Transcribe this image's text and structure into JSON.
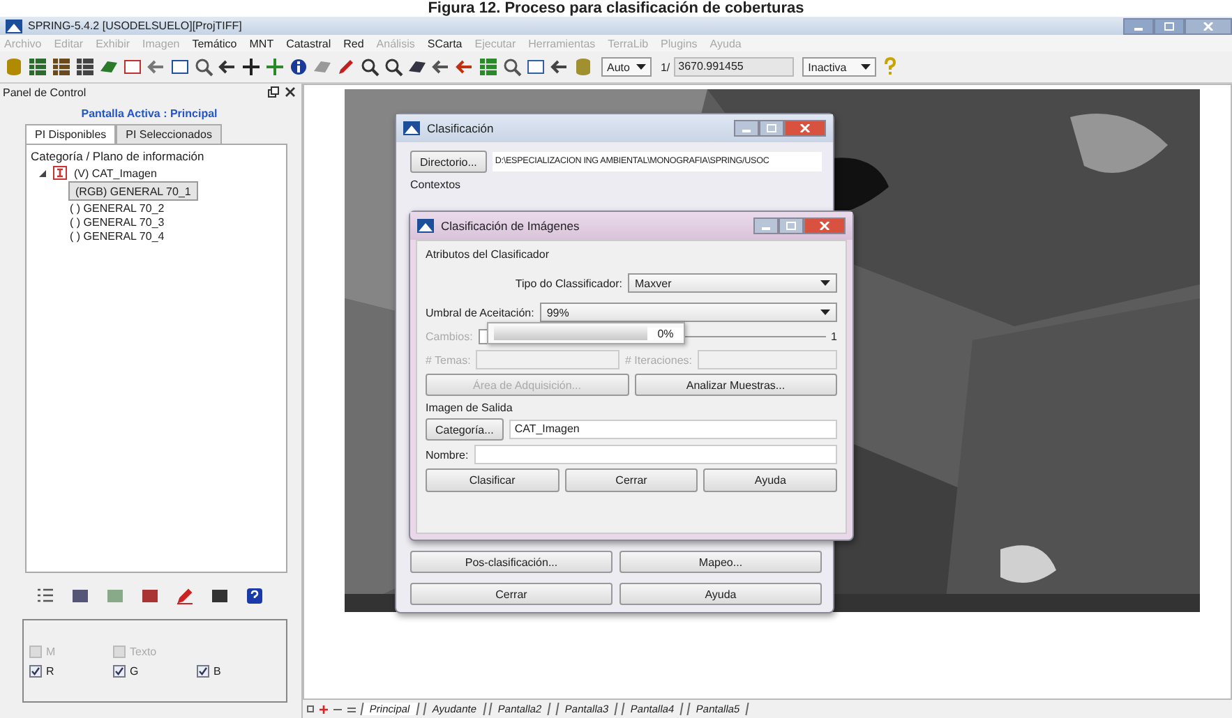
{
  "caption": "Figura 12. Proceso para clasificación de coberturas",
  "window": {
    "title": "SPRING-5.4.2 [USODELSUELO][ProjTIFF]"
  },
  "menu": [
    {
      "label": "Archivo",
      "disabled": true
    },
    {
      "label": "Editar",
      "disabled": true
    },
    {
      "label": "Exhibir",
      "disabled": true
    },
    {
      "label": "Imagen",
      "disabled": true
    },
    {
      "label": "Temático",
      "disabled": false
    },
    {
      "label": "MNT",
      "disabled": false
    },
    {
      "label": "Catastral",
      "disabled": false
    },
    {
      "label": "Red",
      "disabled": false
    },
    {
      "label": "Análisis",
      "disabled": true
    },
    {
      "label": "SCarta",
      "disabled": false
    },
    {
      "label": "Ejecutar",
      "disabled": true
    },
    {
      "label": "Herramientas",
      "disabled": true
    },
    {
      "label": "TerraLib",
      "disabled": true
    },
    {
      "label": "Plugins",
      "disabled": true
    },
    {
      "label": "Ayuda",
      "disabled": true
    }
  ],
  "toolbar": {
    "zoom_mode": "Auto",
    "scale_prefix": "1/",
    "scale": "3670.991455",
    "status": "Inactiva"
  },
  "control_panel": {
    "title": "Panel de Control",
    "active_screen": "Pantalla Activa : Principal",
    "tabs": [
      {
        "label": "PI Disponibles",
        "selected": true
      },
      {
        "label": "PI Seleccionados",
        "selected": false
      }
    ],
    "tree_header": "Categoría / Plano de información",
    "tree": [
      {
        "label": "(V) CAT_Imagen",
        "expanded": true,
        "selected": false,
        "children": [
          {
            "label": "(RGB) GENERAL 70_1",
            "selected": true
          },
          {
            "label": "( ) GENERAL 70_2",
            "selected": false
          },
          {
            "label": "( ) GENERAL 70_3",
            "selected": false
          },
          {
            "label": "( ) GENERAL 70_4",
            "selected": false
          }
        ]
      }
    ],
    "channels": [
      {
        "label": "M",
        "checked": false,
        "disabled": true
      },
      {
        "label": "Texto",
        "checked": false,
        "disabled": true
      },
      {
        "label": "R",
        "checked": true,
        "disabled": false
      },
      {
        "label": "G",
        "checked": true,
        "disabled": false
      },
      {
        "label": "B",
        "checked": true,
        "disabled": false
      }
    ]
  },
  "screen_tabs": [
    {
      "label": "Principal",
      "selected": true
    },
    {
      "label": "Ayudante",
      "selected": false
    },
    {
      "label": "Pantalla2",
      "selected": false
    },
    {
      "label": "Pantalla3",
      "selected": false
    },
    {
      "label": "Pantalla4",
      "selected": false
    },
    {
      "label": "Pantalla5",
      "selected": false
    }
  ],
  "classification_dialog": {
    "title": "Clasificación",
    "directory_button": "Directorio...",
    "path": "D:\\ESPECIALIZACION ING AMBIENTAL\\MONOGRAFIA\\SPRING/USOC",
    "contexts_label": "Contextos",
    "buttons": [
      "Pos-clasificación...",
      "Mapeo...",
      "Cerrar",
      "Ayuda"
    ]
  },
  "image_dialog": {
    "title": "Clasificación de Imágenes",
    "section": "Atributos del Clasificador",
    "classifier_label": "Tipo do Classificador:",
    "classifier": "Maxver",
    "threshold_label": "Umbral de Aceitación:",
    "threshold": "99%",
    "changes": {
      "label": "Cambios:",
      "max": "1",
      "disabled": true,
      "level": 0
    },
    "progress": {
      "level": 0,
      "reading": "0%"
    },
    "themes": {
      "label": "# Temas:",
      "disabled": true
    },
    "iterations": {
      "label": "# Iteraciones:",
      "disabled": true
    },
    "acquisition_button": {
      "label": "Área de Adquisición...",
      "disabled": true
    },
    "analyze_button": {
      "label": "Analizar Muestras...",
      "disabled": false
    },
    "output_section": "Imagen de Salida",
    "category_button": "Categoría...",
    "category": "CAT_Imagen",
    "name_label": "Nombre:",
    "buttons": [
      "Clasificar",
      "Cerrar",
      "Ayuda"
    ]
  }
}
